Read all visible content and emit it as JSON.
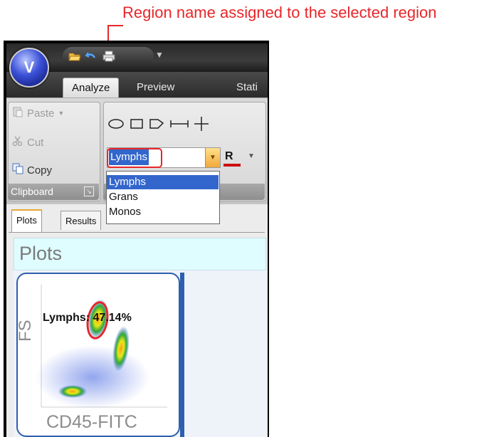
{
  "annotation": {
    "text": "Region name assigned to the selected region"
  },
  "app": {
    "logo_letter": "V"
  },
  "tabs": [
    {
      "label": "Analyze"
    },
    {
      "label": "Preview"
    },
    {
      "label": "Stati"
    }
  ],
  "clipboard": {
    "paste": "Paste",
    "cut": "Cut",
    "copy": "Copy",
    "group_label": "Clipboard"
  },
  "region": {
    "selected_name": "Lymphs",
    "color_button": "R",
    "options": [
      "Lymphs",
      "Grans",
      "Monos"
    ]
  },
  "panel": {
    "tabs": [
      {
        "label": "Plots"
      },
      {
        "label": "Results"
      }
    ],
    "title": "Plots"
  },
  "plot": {
    "gate_label": "Lymphs: 47.14%",
    "y_axis": "FS",
    "x_axis": "CD45-FITC"
  },
  "colors": {
    "annotation": "#e8262a",
    "selection": "#3366cc",
    "plot_border": "#2e5fae"
  }
}
